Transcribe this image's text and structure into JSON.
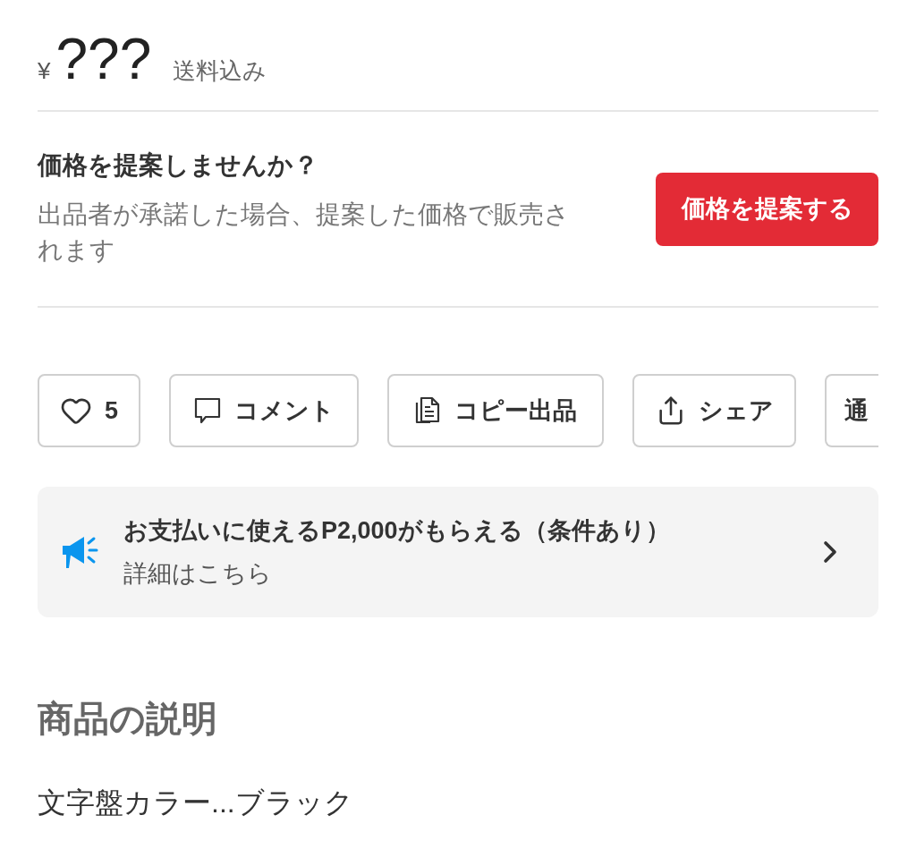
{
  "price": {
    "currency": "¥",
    "amount": "???",
    "shipping_note": "送料込み"
  },
  "offer": {
    "title": "価格を提案しませんか？",
    "description": "出品者が承諾した場合、提案した価格で販売されます",
    "button": "価格を提案する"
  },
  "actions": [
    {
      "kind": "like",
      "label": "5"
    },
    {
      "kind": "comment",
      "label": "コメント"
    },
    {
      "kind": "copy",
      "label": "コピー出品"
    },
    {
      "kind": "share",
      "label": "シェア"
    },
    {
      "kind": "cut",
      "label": "通"
    }
  ],
  "promo": {
    "title": "お支払いに使えるP2,000がもらえる（条件あり）",
    "link": "詳細はこちら"
  },
  "description": {
    "heading": "商品の説明",
    "text": "文字盤カラー...ブラック"
  }
}
